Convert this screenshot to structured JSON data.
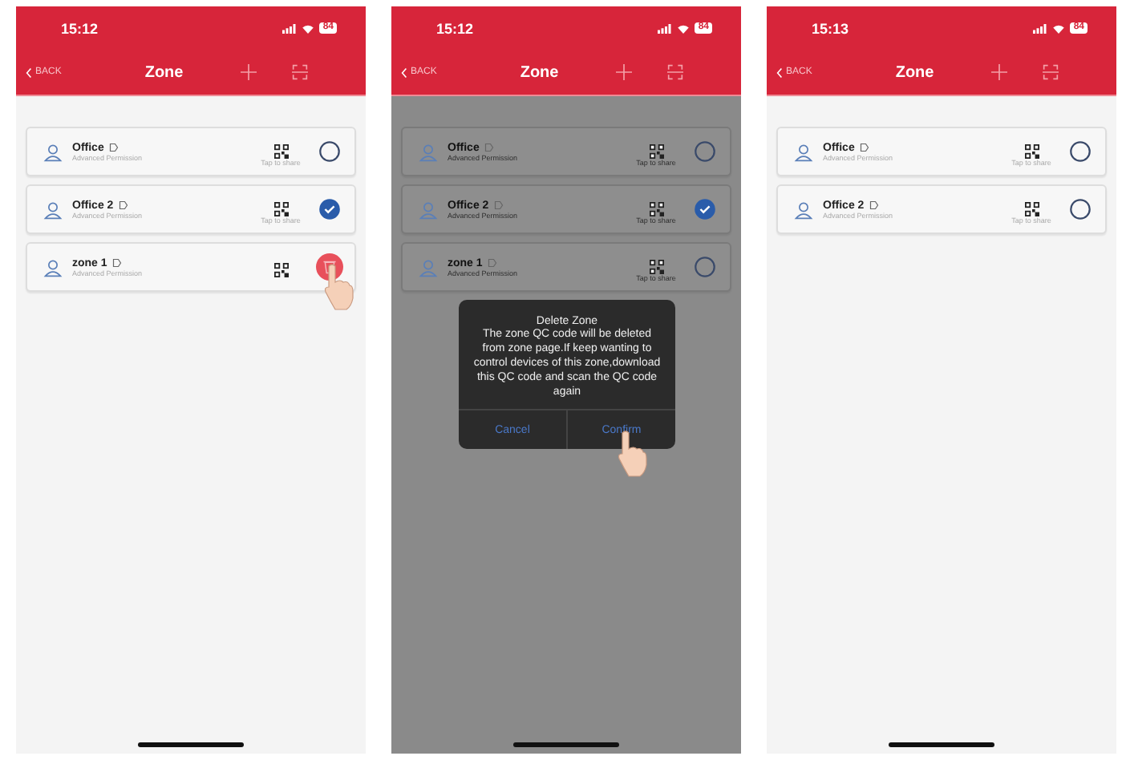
{
  "screens": [
    {
      "time": "15:12",
      "battery": "84",
      "back": "BACK",
      "title": "Zone",
      "zones": [
        {
          "name": "Office",
          "subtitle": "Advanced Permission",
          "share": "Tap to share",
          "kind": "select",
          "selected": false,
          "tapped": false
        },
        {
          "name": "Office 2",
          "subtitle": "Advanced Permission",
          "share": "Tap to share",
          "kind": "select",
          "selected": true,
          "tapped": false
        },
        {
          "name": "zone 1",
          "subtitle": "Advanced Permission",
          "kind": "delete",
          "tapped": true
        }
      ]
    },
    {
      "time": "15:12",
      "battery": "84",
      "back": "BACK",
      "title": "Zone",
      "dimmed": true,
      "zones": [
        {
          "name": "Office",
          "subtitle": "Advanced Permission",
          "share": "Tap to share",
          "kind": "select",
          "selected": false,
          "tapped": false
        },
        {
          "name": "Office 2",
          "subtitle": "Advanced Permission",
          "share": "Tap to share",
          "kind": "select",
          "selected": true,
          "tapped": false
        },
        {
          "name": "zone 1",
          "subtitle": "Advanced Permission",
          "share": "Tap to share",
          "kind": "select",
          "selected": false,
          "tapped": false
        }
      ],
      "dialog": {
        "title": "Delete Zone",
        "message": "The zone QC code will be deleted from zone page.If keep wanting to control devices of this zone,download this QC code and scan the QC code again",
        "buttons": [
          {
            "label": "Cancel",
            "tapped": false
          },
          {
            "label": "Confirm",
            "tapped": true
          }
        ]
      }
    },
    {
      "time": "15:13",
      "battery": "84",
      "back": "BACK",
      "title": "Zone",
      "zones": [
        {
          "name": "Office",
          "subtitle": "Advanced Permission",
          "share": "Tap to share",
          "kind": "select",
          "selected": false,
          "tapped": false
        },
        {
          "name": "Office 2",
          "subtitle": "Advanced Permission",
          "share": "Tap to share",
          "kind": "select",
          "selected": false,
          "tapped": false
        }
      ]
    }
  ]
}
